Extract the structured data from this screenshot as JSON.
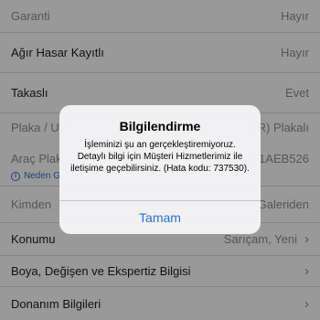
{
  "rows": [
    {
      "label": "Garanti",
      "value": "Hayır"
    },
    {
      "label": "Ağır Hasar Kayıtlı",
      "value": "Hayır"
    },
    {
      "label": "Takaslı",
      "value": "Evet"
    },
    {
      "label": "Plaka / Uy",
      "value": "TR) Plakalı"
    },
    {
      "label": "Araç Plak",
      "value": "01AEB526"
    },
    {
      "label": "Kimden",
      "value": "Galeriden"
    },
    {
      "label": "Konumu",
      "value": "Sarıçam, Yeni"
    },
    {
      "label": "Boya, Değişen ve Ekspertiz Bilgisi",
      "value": ""
    },
    {
      "label": "Donanım Bilgileri",
      "value": ""
    }
  ],
  "plate_hint": "Neden G",
  "alert": {
    "title": "Bilgilendirme",
    "message": "İşleminizi şu an gerçekleştiremiyoruz. Detaylı bilgi için Müşteri Hizmetlerimiz ile iletişime geçebilirsiniz. (Hata kodu: 737530).",
    "button": "Tamam"
  },
  "colors": {
    "accent": "#2b6ed1",
    "muted": "#8e8e93"
  }
}
